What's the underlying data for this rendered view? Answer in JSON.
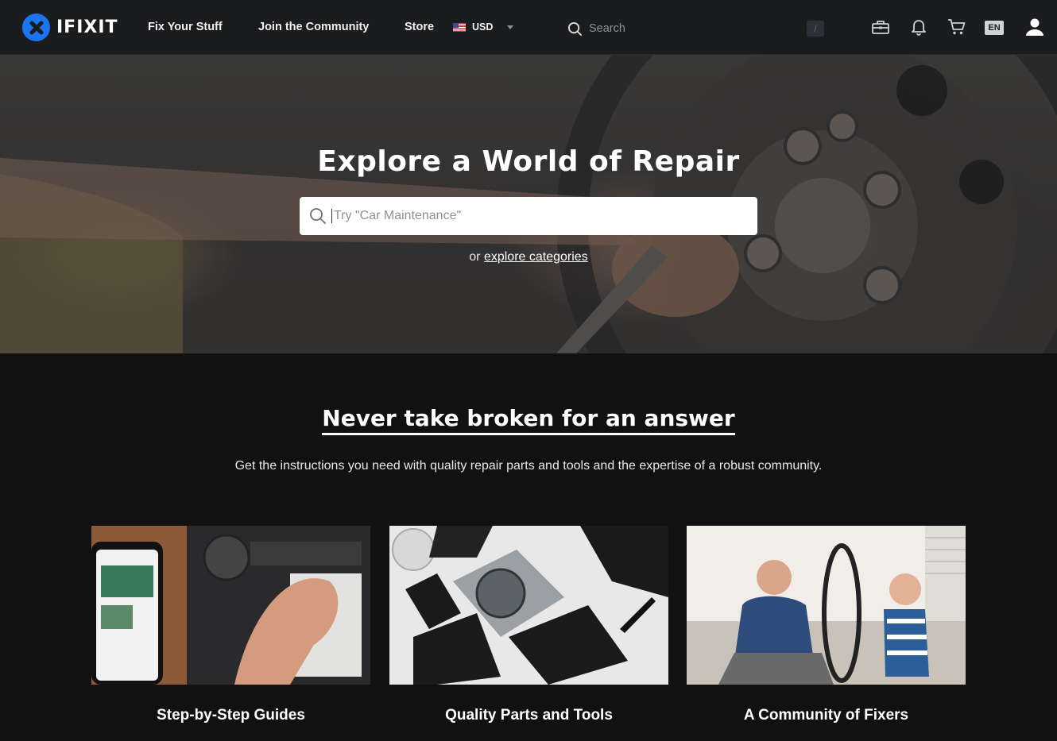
{
  "nav": {
    "logo_text": "IFIXIT",
    "links": [
      "Fix Your Stuff",
      "Join the Community",
      "Store"
    ],
    "currency": "USD",
    "search_placeholder": "Search",
    "search_shortcut": "/",
    "language": "EN",
    "icons": [
      "toolbox-icon",
      "bell-icon",
      "cart-icon",
      "user-icon"
    ]
  },
  "hero": {
    "title": "Explore a World of Repair",
    "search_placeholder": "Try \"Car Maintenance\"",
    "or_text": "or ",
    "link_text": "explore categories"
  },
  "section": {
    "title": "Never take broken for an answer",
    "subtitle": "Get the instructions you need with quality repair parts and tools and the expertise of a robust community."
  },
  "cards": [
    {
      "label": "Step-by-Step Guides"
    },
    {
      "label": "Quality Parts and Tools"
    },
    {
      "label": "A Community of Fixers"
    }
  ],
  "colors": {
    "brand": "#1975f2",
    "nav_bg": "#1b1c1e",
    "page_bg": "#111111"
  }
}
